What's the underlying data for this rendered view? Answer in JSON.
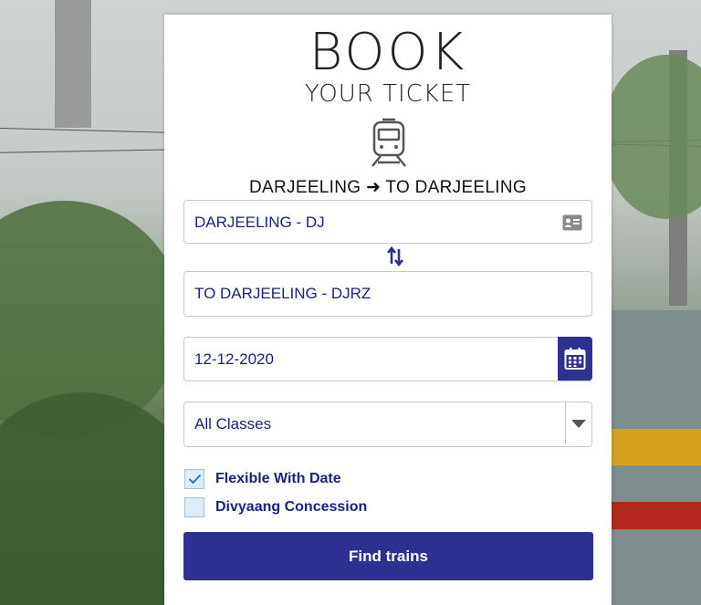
{
  "brand": {
    "line1": "BOOK",
    "line2": "YOUR TICKET"
  },
  "route": {
    "from": "DARJEELING",
    "arrow": "➜",
    "to": "TO DARJEELING"
  },
  "from_station": {
    "value": "DARJEELING - DJ",
    "icon": "id-card-icon"
  },
  "swap_icon": "swap-vertical-icon",
  "to_station": {
    "value": "TO DARJEELING - DJRZ"
  },
  "journey_date": {
    "value": "12-12-2020",
    "icon": "calendar-icon"
  },
  "class_select": {
    "value": "All Classes",
    "icon": "caret-down-icon"
  },
  "options": {
    "flexible": {
      "label": "Flexible With Date",
      "checked": true
    },
    "divyaang": {
      "label": "Divyaang Concession",
      "checked": false
    }
  },
  "submit": {
    "label": "Find trains"
  },
  "colors": {
    "primary": "#2e3192",
    "text_blue": "#1a237e",
    "checkbox_bg": "#dcecf8"
  }
}
